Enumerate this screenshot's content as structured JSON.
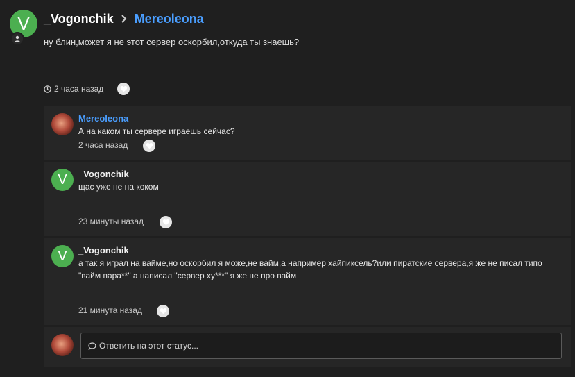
{
  "status": {
    "author_initial": "V",
    "author": "_Vogonchik",
    "target": "Mereoleona",
    "text": "ну блин,может я не этот сервер оскорбил,откуда ты знаешь?",
    "time": "2 часа назад"
  },
  "comments": [
    {
      "author": "Mereoleona",
      "text": "А на каком ты сервере играешь сейчас?",
      "time": "2 часа назад"
    },
    {
      "author_initial": "V",
      "author": "_Vogonchik",
      "text": "щас уже не на коком",
      "time": "23 минуты назад"
    },
    {
      "author_initial": "V",
      "author": "_Vogonchik",
      "text": "а так я играл на вайме,но оскорбил я може,не вайм,а например хайпиксель?или пиратские сервера,я же не писал типо \"вайм пара**\" а написал \"сервер ху***\" я же не про вайм",
      "time": "21 минута назад"
    }
  ],
  "reply": {
    "placeholder": "Ответить на этот статус..."
  },
  "colors": {
    "accent": "#4a9eff",
    "avatar_green": "#4caf50",
    "background": "#1f1f1f",
    "card": "#262626"
  },
  "icons": [
    "user-icon",
    "chevron-right-icon",
    "clock-icon",
    "heart-icon",
    "comment-icon"
  ]
}
